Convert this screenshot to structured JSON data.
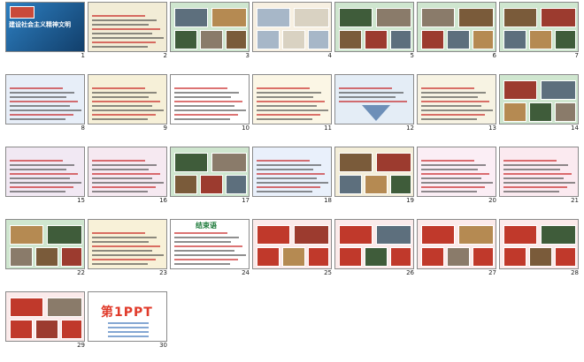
{
  "window": {
    "title": ""
  },
  "slides": [
    {
      "num": "1",
      "style": "title",
      "heading": "建设社会主义精神文明",
      "bg": "#1e5b8f"
    },
    {
      "num": "2",
      "style": "text",
      "heading": "",
      "bg": "#f2ecd6"
    },
    {
      "num": "3",
      "style": "photos",
      "heading": "",
      "bg": "#cfe6cf"
    },
    {
      "num": "4",
      "style": "cartoon",
      "heading": "",
      "bg": "#f7f0e2"
    },
    {
      "num": "5",
      "style": "photos",
      "heading": "",
      "bg": "#cfe6cf"
    },
    {
      "num": "6",
      "style": "photos",
      "heading": "",
      "bg": "#cfe6cf"
    },
    {
      "num": "7",
      "style": "photos",
      "heading": "",
      "bg": "#cfe6cf"
    },
    {
      "num": "8",
      "style": "text",
      "heading": "",
      "bg": "#e7eef8"
    },
    {
      "num": "9",
      "style": "text",
      "heading": "",
      "bg": "#f6f0d8"
    },
    {
      "num": "10",
      "style": "text",
      "heading": "",
      "bg": "#ffffff"
    },
    {
      "num": "11",
      "style": "text",
      "heading": "",
      "bg": "#fbf6e5"
    },
    {
      "num": "12",
      "style": "diagram",
      "heading": "",
      "bg": "#e4edf6"
    },
    {
      "num": "13",
      "style": "text",
      "heading": "",
      "bg": "#f7f3e3"
    },
    {
      "num": "14",
      "style": "photos",
      "heading": "",
      "bg": "#cfe6cf"
    },
    {
      "num": "15",
      "style": "text",
      "heading": "",
      "bg": "#f1e8f3"
    },
    {
      "num": "16",
      "style": "text",
      "heading": "",
      "bg": "#f6e9f1"
    },
    {
      "num": "17",
      "style": "photos",
      "heading": "",
      "bg": "#cfe6cf"
    },
    {
      "num": "18",
      "style": "text",
      "heading": "",
      "bg": "#e9f0fb"
    },
    {
      "num": "19",
      "style": "photos",
      "heading": "",
      "bg": "#f4eed9"
    },
    {
      "num": "20",
      "style": "text",
      "heading": "",
      "bg": "#fbeef5"
    },
    {
      "num": "21",
      "style": "text",
      "heading": "",
      "bg": "#fbeaf0"
    },
    {
      "num": "22",
      "style": "photos",
      "heading": "",
      "bg": "#cfe6cf"
    },
    {
      "num": "23",
      "style": "text",
      "heading": "",
      "bg": "#f8f1d8"
    },
    {
      "num": "24",
      "style": "text",
      "heading": "结束语",
      "bg": "#ffffff"
    },
    {
      "num": "25",
      "style": "redphotos",
      "heading": "",
      "bg": "#fbeaea"
    },
    {
      "num": "26",
      "style": "redphotos",
      "heading": "",
      "bg": "#fbeaea"
    },
    {
      "num": "27",
      "style": "redphotos",
      "heading": "",
      "bg": "#fbeaea"
    },
    {
      "num": "28",
      "style": "redphotos",
      "heading": "",
      "bg": "#fbeaea"
    },
    {
      "num": "29",
      "style": "redphotos",
      "heading": "",
      "bg": "#fbeaea"
    },
    {
      "num": "30",
      "style": "logo",
      "heading": "第1PPT",
      "bg": "#ffffff"
    }
  ]
}
